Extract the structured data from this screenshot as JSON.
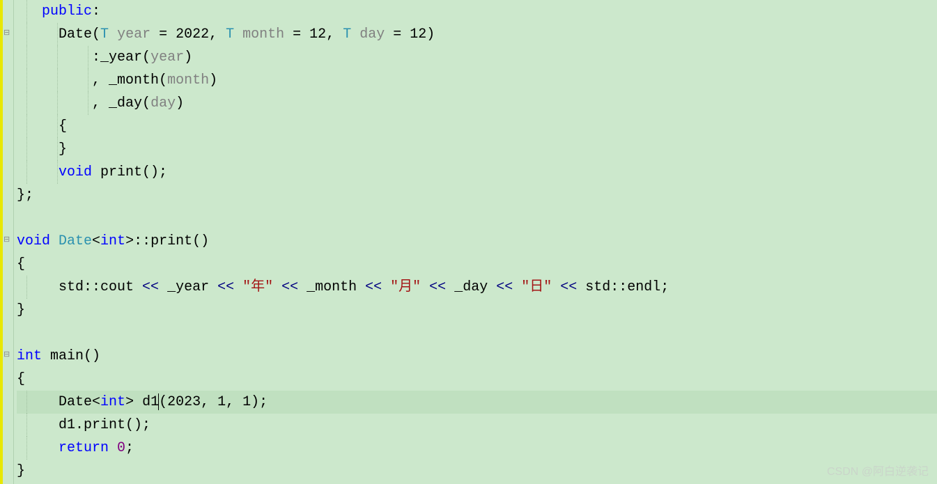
{
  "code": {
    "line1_public": "public",
    "line1_colon": ":",
    "line2_date": "Date",
    "line2_paren_open": "(",
    "line2_T1": "T",
    "line2_year": " year ",
    "line2_eq1": "= ",
    "line2_2022": "2022",
    "line2_comma1": ", ",
    "line2_T2": "T",
    "line2_month": " month ",
    "line2_eq2": "= ",
    "line2_12a": "12",
    "line2_comma2": ", ",
    "line2_T3": "T",
    "line2_day": " day ",
    "line2_eq3": "= ",
    "line2_12b": "12",
    "line2_paren_close": ")",
    "line3_colon_year": ":_year",
    "line3_paren": "(",
    "line3_year_param": "year",
    "line3_close": ")",
    "line4_comma_month": ", _month",
    "line4_paren": "(",
    "line4_month_param": "month",
    "line4_close": ")",
    "line5_comma_day": ", _day",
    "line5_paren": "(",
    "line5_day_param": "day",
    "line5_close": ")",
    "line6_brace": "{",
    "line7_brace": "}",
    "line8_void": "void",
    "line8_print": " print",
    "line8_parens": "();",
    "line9_close": "};",
    "line11_void": "void",
    "line11_date": " Date",
    "line11_int_open": "<",
    "line11_int": "int",
    "line11_int_close": ">::",
    "line11_print": "print",
    "line11_parens": "()",
    "line12_brace": "{",
    "line13_std_cout": "std::cout ",
    "line13_op1": "<<",
    "line13_year": " _year ",
    "line13_op2": "<<",
    "line13_str_year": " \"年\" ",
    "line13_op3": "<<",
    "line13_month": " _month ",
    "line13_op4": "<<",
    "line13_str_month": " \"月\" ",
    "line13_op5": "<<",
    "line13_day": " _day ",
    "line13_op6": "<<",
    "line13_str_day": " \"日\" ",
    "line13_op7": "<<",
    "line13_endl": " std::endl;",
    "line14_brace": "}",
    "line16_int": "int",
    "line16_main": " main",
    "line16_parens": "()",
    "line17_brace": "{",
    "line18_date": "Date",
    "line18_open": "<",
    "line18_int": "int",
    "line18_close": "> ",
    "line18_d1": "d1",
    "line18_args": "(2023, 1, 1);",
    "line19_d1print": "d1.print();",
    "line20_return": "return",
    "line20_zero": " 0",
    "line20_semi": ";",
    "line21_brace": "}"
  },
  "watermark": "CSDN @阿白逆袭记"
}
